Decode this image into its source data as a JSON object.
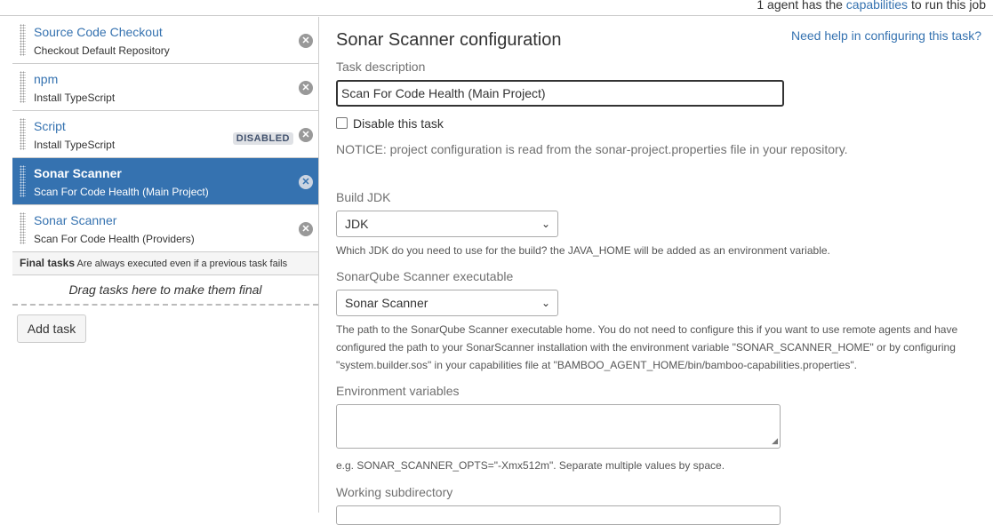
{
  "agent_bar": {
    "prefix": "1 agent has the ",
    "link": "capabilities",
    "suffix": " to run this job"
  },
  "tasks": [
    {
      "name": "Source Code Checkout",
      "description": "Checkout Default Repository",
      "badge": ""
    },
    {
      "name": "npm",
      "description": "Install TypeScript",
      "badge": ""
    },
    {
      "name": "Script",
      "description": "Install TypeScript",
      "badge": "DISABLED"
    },
    {
      "name": "Sonar Scanner",
      "description": "Scan For Code Health (Main Project)",
      "badge": ""
    },
    {
      "name": "Sonar Scanner",
      "description": "Scan For Code Health (Providers)",
      "badge": ""
    }
  ],
  "final_tasks": {
    "title": "Final tasks",
    "note": "Are always executed even if a previous task fails",
    "drop_text": "Drag tasks here to make them final"
  },
  "add_task_label": "Add task",
  "config": {
    "title": "Sonar Scanner configuration",
    "help_link": "Need help in configuring this task?",
    "task_description_label": "Task description",
    "task_description_value": "Scan For Code Health (Main Project)",
    "disable_label": "Disable this task",
    "notice": "NOTICE: project configuration is read from the sonar-project.properties file in your repository.",
    "build_jdk_label": "Build JDK",
    "build_jdk_value": "JDK",
    "build_jdk_hint": "Which JDK do you need to use for the build? the JAVA_HOME will be added as an environment variable.",
    "scanner_label": "SonarQube Scanner executable",
    "scanner_value": "Sonar Scanner",
    "scanner_hint_1": "The path to the SonarQube Scanner executable home. You do not need to configure this if you want to use remote agents and have",
    "scanner_hint_2": "configured the path to your SonarScanner installation with the environment variable \"SONAR_SCANNER_HOME\" or by configuring",
    "scanner_hint_3": "\"system.builder.sos\" in your capabilities file at \"BAMBOO_AGENT_HOME/bin/bamboo-capabilities.properties\".",
    "env_label": "Environment variables",
    "env_value": "",
    "env_hint": "e.g. SONAR_SCANNER_OPTS=\"-Xmx512m\". Separate multiple values by space.",
    "workdir_label": "Working subdirectory"
  }
}
